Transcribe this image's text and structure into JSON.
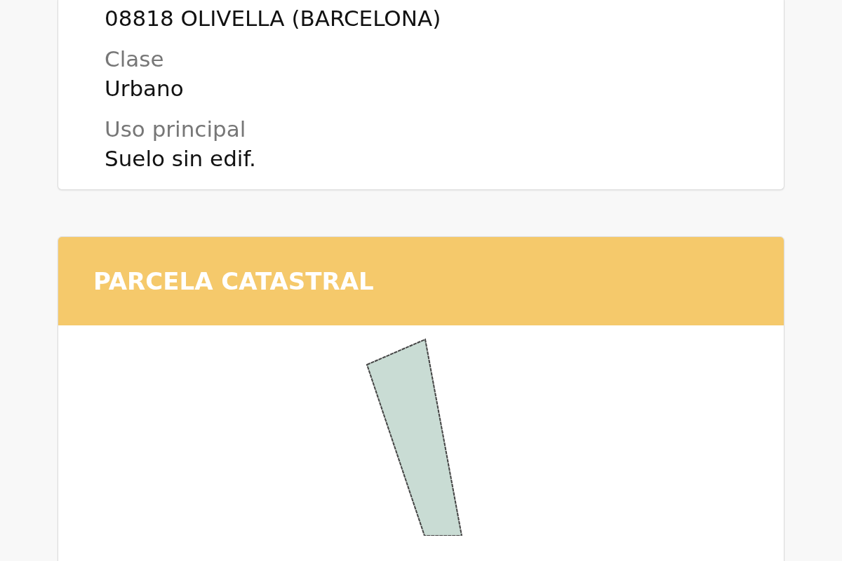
{
  "location_card": {
    "address_line": "08818 OLIVELLA (BARCELONA)",
    "fields": [
      {
        "label": "Clase",
        "value": "Urbano"
      },
      {
        "label": "Uso principal",
        "value": "Suelo sin edif."
      }
    ]
  },
  "parcel_card": {
    "title": "PARCELA CATASTRAL"
  }
}
